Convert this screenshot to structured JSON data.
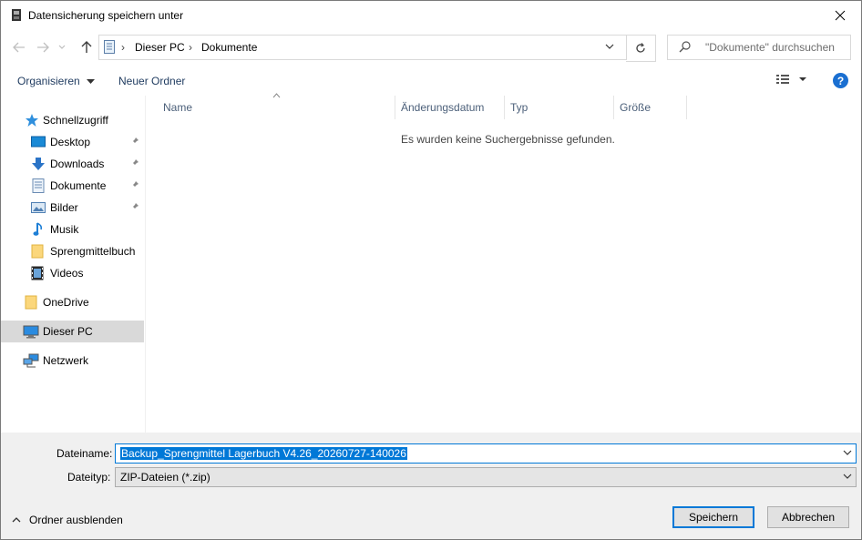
{
  "window": {
    "title": "Datensicherung speichern unter"
  },
  "address_bar": {
    "crumbs": [
      "Dieser PC",
      "Dokumente"
    ]
  },
  "search": {
    "placeholder": "\"Dokumente\" durchsuchen"
  },
  "command_bar": {
    "organize_label": "Organisieren",
    "new_folder_label": "Neuer Ordner",
    "help_label": "?"
  },
  "sidebar": {
    "quick_access": "Schnellzugriff",
    "items": [
      {
        "label": "Desktop",
        "icon": "desktop-icon",
        "pinned": true
      },
      {
        "label": "Downloads",
        "icon": "download-icon",
        "pinned": true
      },
      {
        "label": "Dokumente",
        "icon": "document-icon",
        "pinned": true
      },
      {
        "label": "Bilder",
        "icon": "pictures-icon",
        "pinned": true
      },
      {
        "label": "Musik",
        "icon": "music-icon",
        "pinned": false
      },
      {
        "label": "Sprengmittelbuch",
        "icon": "folder-icon",
        "pinned": false
      },
      {
        "label": "Videos",
        "icon": "videos-icon",
        "pinned": false
      }
    ],
    "onedrive": "OneDrive",
    "this_pc": "Dieser PC",
    "network": "Netzwerk"
  },
  "file_list": {
    "columns": [
      "Name",
      "Änderungsdatum",
      "Typ",
      "Größe"
    ],
    "empty_message": "Es wurden keine Suchergebnisse gefunden."
  },
  "footer": {
    "filename_label": "Dateiname:",
    "filename_value": "Backup_Sprengmittel Lagerbuch V4.26_20260727-140026",
    "filetype_label": "Dateityp:",
    "filetype_value": "ZIP-Dateien (*.zip)",
    "hide_folders_label": "Ordner ausblenden",
    "save_label": "Speichern",
    "cancel_label": "Abbrechen"
  },
  "colors": {
    "accent": "#0078d7",
    "selection_bg": "#d9d9d9",
    "footer_bg": "#f0f0f0"
  }
}
